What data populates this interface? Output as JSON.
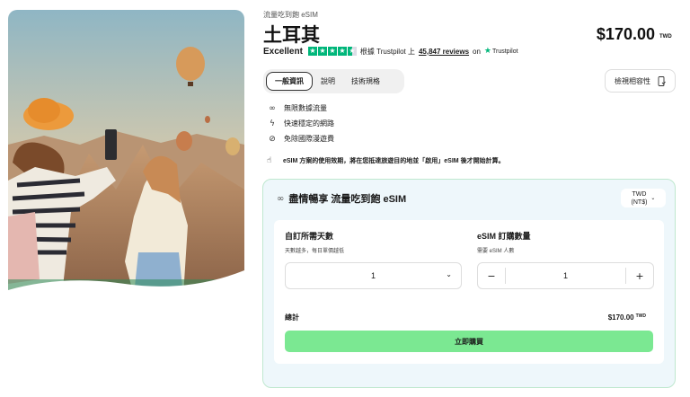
{
  "product": {
    "breadcrumb": "流量吃到飽 eSIM",
    "title": "土耳其",
    "price": "$170.00",
    "currency": "TWD"
  },
  "trustpilot": {
    "rating_word": "Excellent",
    "stars": 4.5,
    "based_on": "根據 Trustpilot 上",
    "reviews": "45,847 reviews",
    "on": "on",
    "brand": "Trustpilot",
    "color": "#00b67a"
  },
  "tabs": [
    {
      "label": "一般資訊",
      "active": true
    },
    {
      "label": "說明",
      "active": false
    },
    {
      "label": "技術規格",
      "active": false
    }
  ],
  "compat_button": {
    "label": "檢視相容性",
    "icon": "phone-check-icon"
  },
  "features": [
    {
      "icon": "infinity-icon",
      "label": "無限數據流量"
    },
    {
      "icon": "lightning-icon",
      "label": "快速穩定的網路"
    },
    {
      "icon": "no-roaming-icon",
      "label": "免除國際漫遊費"
    }
  ],
  "notice": {
    "icon": "tap-icon",
    "text": "eSIM 方案的使用效期，將在您抵達旅遊目的地並「啟用」eSIM 後才開始計算。"
  },
  "plan": {
    "title": "盡情暢享 流量吃到飽 eSIM",
    "currency_select": {
      "line1": "TWD",
      "line2": "(NT$)"
    },
    "days": {
      "label": "自訂所需天數",
      "hint": "天數越多，每日單價越低",
      "value": "1"
    },
    "quantity": {
      "label": "eSIM 訂購數量",
      "hint": "需要 eSIM 人數",
      "value": "1",
      "minus": "−",
      "plus": "+"
    },
    "total": {
      "label": "總計",
      "value": "$170.00",
      "currency": "TWD"
    },
    "buy_label": "立即購買",
    "buy_color": "#7be892"
  }
}
